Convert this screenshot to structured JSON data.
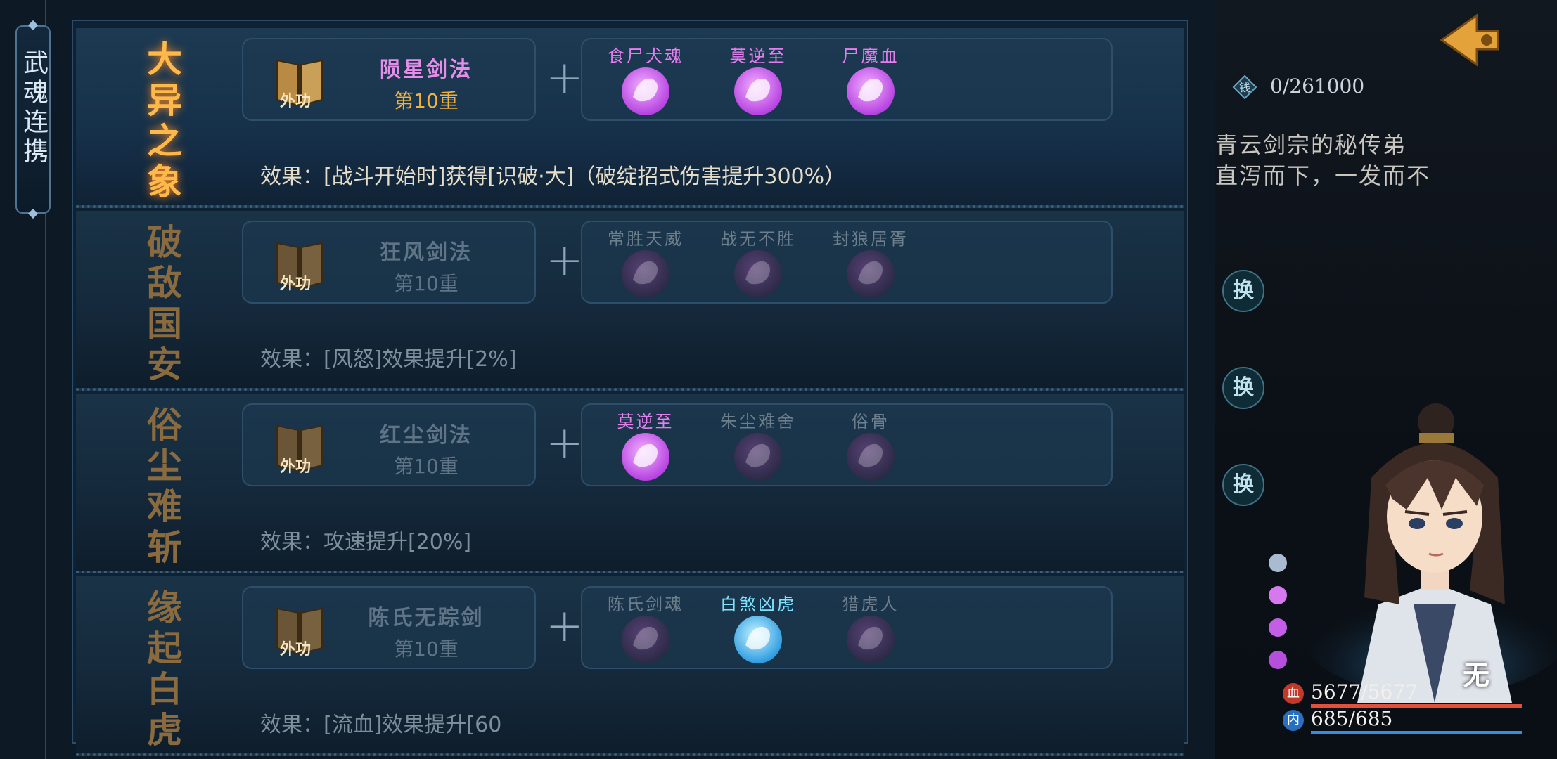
{
  "side_tab": {
    "label": "武魂连携"
  },
  "combos": [
    {
      "title": "大异之象",
      "active": true,
      "skill": {
        "badge": "外功",
        "name": "陨星剑法",
        "level": "第10重"
      },
      "souls": [
        {
          "name": "食尸犬魂",
          "lit": "purple"
        },
        {
          "name": "莫逆至",
          "lit": "purple"
        },
        {
          "name": "尸魔血",
          "lit": "purple"
        }
      ],
      "effect": "效果：[战斗开始时]获得[识破·大]（破绽招式伤害提升300%）"
    },
    {
      "title": "破敌国安",
      "active": false,
      "skill": {
        "badge": "外功",
        "name": "狂风剑法",
        "level": "第10重"
      },
      "souls": [
        {
          "name": "常胜天威",
          "lit": "dim"
        },
        {
          "name": "战无不胜",
          "lit": "dim"
        },
        {
          "name": "封狼居胥",
          "lit": "dim"
        }
      ],
      "effect": "效果：[风怒]效果提升[2%]"
    },
    {
      "title": "俗尘难斩",
      "active": false,
      "skill": {
        "badge": "外功",
        "name": "红尘剑法",
        "level": "第10重"
      },
      "souls": [
        {
          "name": "莫逆至",
          "lit": "purple"
        },
        {
          "name": "朱尘难舍",
          "lit": "dim"
        },
        {
          "name": "俗骨",
          "lit": "dim"
        }
      ],
      "effect": "效果：攻速提升[20%]"
    },
    {
      "title": "缘起白虎",
      "active": false,
      "skill": {
        "badge": "外功",
        "name": "陈氏无踪剑",
        "level": "第10重"
      },
      "souls": [
        {
          "name": "陈氏剑魂",
          "lit": "dim"
        },
        {
          "name": "白煞凶虎",
          "lit": "blue"
        },
        {
          "name": "猎虎人",
          "lit": "dim"
        }
      ],
      "effect": "效果：[流血]效果提升[60"
    }
  ],
  "currency": {
    "value": "0/261000",
    "icon": "coin-icon"
  },
  "lore": [
    "青云剑宗的秘传弟",
    "直泻而下，一发而不"
  ],
  "swap_buttons": [
    "换",
    "换",
    "换"
  ],
  "character": {
    "badge": "无",
    "hp_label": "血",
    "hp": "5677/5677",
    "mp_label": "内",
    "mp": "685/685"
  },
  "colors": {
    "active_title": "#ffb84a",
    "skill_name_active": "#e58ee8",
    "level_active": "#f0b13e",
    "soul_purple": "#e77ef0",
    "soul_blue": "#7fe3ff",
    "hp_bar": "#e0503a",
    "mp_bar": "#3a8ce0"
  }
}
